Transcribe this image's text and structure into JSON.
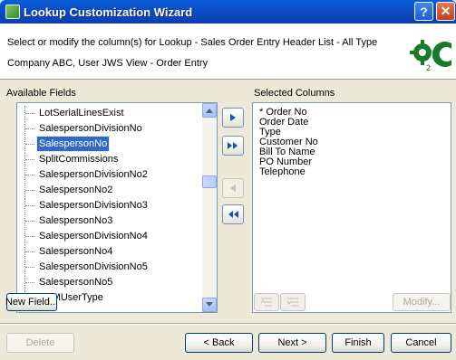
{
  "window": {
    "title": "Lookup Customization Wizard",
    "help_label": "?",
    "close_label": "✕"
  },
  "header": {
    "line1": "Select or modify the column(s) for Lookup - Sales Order Entry Header List - All Type",
    "line2": "Company ABC, User JWS View - Order Entry"
  },
  "available": {
    "label": "Available Fields",
    "items": [
      {
        "label": "LotSerialLinesExist",
        "selected": false
      },
      {
        "label": "SalespersonDivisionNo",
        "selected": false
      },
      {
        "label": "SalespersonNo",
        "selected": true
      },
      {
        "label": "SplitCommissions",
        "selected": false
      },
      {
        "label": "SalespersonDivisionNo2",
        "selected": false
      },
      {
        "label": "SalespersonNo2",
        "selected": false
      },
      {
        "label": "SalespersonDivisionNo3",
        "selected": false
      },
      {
        "label": "SalespersonNo3",
        "selected": false
      },
      {
        "label": "SalespersonDivisionNo4",
        "selected": false
      },
      {
        "label": "SalespersonNo4",
        "selected": false
      },
      {
        "label": "SalespersonDivisionNo5",
        "selected": false
      },
      {
        "label": "SalespersonNo5",
        "selected": false
      },
      {
        "label": "EBMUserType",
        "selected": false
      }
    ]
  },
  "selected": {
    "label": "Selected Columns",
    "items": [
      "* Order No",
      "Order Date",
      "Type",
      "Customer No",
      "Bill To Name",
      "PO Number",
      "Telephone"
    ]
  },
  "transfer_buttons": {
    "add": "add-icon",
    "add_all": "add-all-icon",
    "remove": "remove-icon",
    "remove_all": "remove-all-icon"
  },
  "buttons": {
    "new_field": "New Field...",
    "modify": "Modify...",
    "delete": "Delete",
    "back": "< Back",
    "next": "Next >",
    "finish": "Finish",
    "cancel": "Cancel"
  }
}
